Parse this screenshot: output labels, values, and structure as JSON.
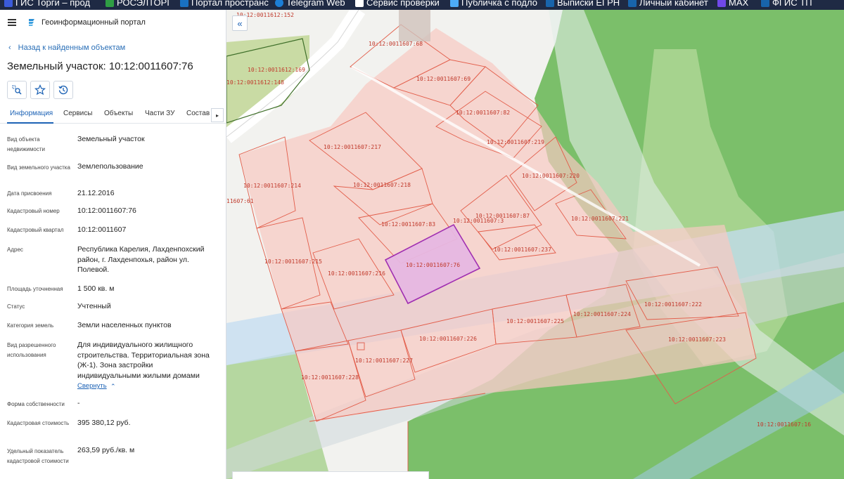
{
  "bookmarks": [
    {
      "label": "ГИС Торги – прод",
      "color": "#3b5bdb"
    },
    {
      "label": "РОСЭЛТОРГ",
      "color": "#2f9e44"
    },
    {
      "label": "Портал пространс",
      "color": "#1971c2"
    },
    {
      "label": "Telegram Web",
      "color": "#1c7ed6"
    },
    {
      "label": "Сервис проверки",
      "color": "#ffffff"
    },
    {
      "label": "Публичка с подло",
      "color": "#4dabf7"
    },
    {
      "label": "Выписки ЕГРН",
      "color": "#1864ab"
    },
    {
      "label": "Личный кабинет",
      "color": "#1864ab"
    },
    {
      "label": "MAX",
      "color": "#7048e8"
    },
    {
      "label": "ФГИС ТП",
      "color": "#1864ab"
    }
  ],
  "app": {
    "title": "Геоинформационный портал"
  },
  "nav": {
    "back_label": "Назад к найденным объектам",
    "back_icon": "chevron-left-icon"
  },
  "object": {
    "title": "Земельный участок: 10:12:0011607:76"
  },
  "toolbar": [
    {
      "name": "locate-object-button",
      "icon": "locate-icon"
    },
    {
      "name": "favorite-button",
      "icon": "star-icon"
    },
    {
      "name": "history-button",
      "icon": "history-icon"
    }
  ],
  "tabs": [
    {
      "label": "Информация",
      "active": true
    },
    {
      "label": "Сервисы",
      "active": false
    },
    {
      "label": "Объекты",
      "active": false
    },
    {
      "label": "Части ЗУ",
      "active": false
    },
    {
      "label": "Состав",
      "active": false
    }
  ],
  "fields": [
    {
      "label": "Вид объекта недвижимости",
      "value": "Земельный участок"
    },
    {
      "label": "Вид земельного участка",
      "value": "Землепользование"
    },
    {
      "label": "Дата присвоения",
      "value": "21.12.2016"
    },
    {
      "label": "Кадастровый номер",
      "value": "10:12:0011607:76"
    },
    {
      "label": "Кадастровый квартал",
      "value": "10:12:0011607"
    },
    {
      "label": "Адрес",
      "value": "Республика Карелия, Лахденпохский район, г. Лахденпохья, район ул. Полевой."
    },
    {
      "label": "Площадь уточненная",
      "value": "1 500 кв. м"
    },
    {
      "label": "Статус",
      "value": "Учтенный"
    },
    {
      "label": "Категория земель",
      "value": "Земли населенных пунктов"
    },
    {
      "label": "Вид разрешенного использования",
      "value": "Для индивидуального жилищного строительства. Территориальная зона (Ж-1). Зона застройки индивидуальными жилыми домами"
    },
    {
      "label": "Форма собственности",
      "value": "-"
    },
    {
      "label": "Кадастровая стоимость",
      "value": "395 380,12 руб."
    },
    {
      "label": "Удельный показатель кадастровой стоимости",
      "value": "263,59 руб./кв. м"
    }
  ],
  "collapse_label": "Свернуть",
  "map": {
    "selected_color": "#9c27b0",
    "parcel_color": "#e25d4a",
    "labels": [
      "10:12:0011612:152",
      "10:12:0011607:68",
      "10:12:0011612:169",
      "10:12:0011612:148",
      "10:12:0011607:69",
      "10:12:0011607:82",
      "10:12:0011607:219",
      "10:12:0011607:217",
      "10:12:0011607:220",
      "10:12:0011607:214",
      "10:12:0011607:218",
      "11607:61",
      "10:12:0011607:87",
      "10:12:0011607:3",
      "10:12:0011607:221",
      "10:12:0011607:83",
      "10:12:0011607:237",
      "10:12:0011607:215",
      "10:12:0011607:76",
      "10:12:0011607:216",
      "10:12:0011607:222",
      "10:12:0011607:224",
      "10:12:0011607:225",
      "10:12:0011607:226",
      "10:12:0011607:223",
      "10:12:0011607:227",
      "10:12:0011607:228",
      "10:12:0011607:16"
    ]
  }
}
